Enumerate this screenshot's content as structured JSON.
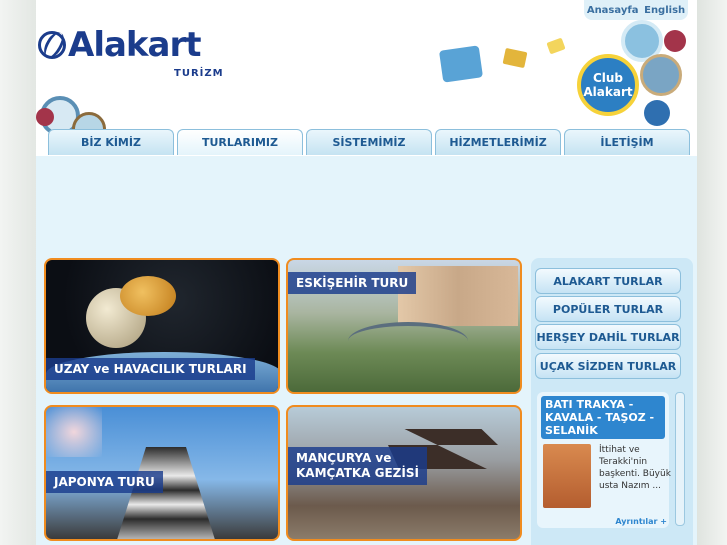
{
  "header": {
    "logo_text": "Alakart",
    "logo_sub": "TURİZM",
    "club_line1": "Club",
    "club_line2": "Alakart"
  },
  "toplinks": {
    "home": "Anasayfa",
    "english": "English"
  },
  "nav": [
    "BİZ KİMİZ",
    "TURLARIMIZ",
    "SİSTEMİMİZ",
    "HİZMETLERİMİZ",
    "İLETİŞİM"
  ],
  "tiles": [
    {
      "label": "UZAY ve HAVACILIK TURLARI"
    },
    {
      "label": "ESKİŞEHİR TURU"
    },
    {
      "label": "JAPONYA TURU"
    },
    {
      "label_l1": "MANÇURYA ve",
      "label_l2": "KAMÇATKA GEZİSİ"
    }
  ],
  "sidebar": {
    "buttons": [
      "ALAKART TURLAR",
      "POPÜLER TURLAR",
      "HERŞEY DAHİL TURLAR",
      "UÇAK SİZDEN TURLAR"
    ],
    "news": {
      "title": "BATI TRAKYA - KAVALA - TAŞOZ - SELANİK",
      "text": "İttihat ve Terakki'nin başkenti. Büyük usta Nazım ...",
      "more": "Ayrıntılar +"
    }
  },
  "colors": {
    "accent": "#f08c1f",
    "brand": "#1b3c8c",
    "nav_text": "#1e5a92"
  }
}
